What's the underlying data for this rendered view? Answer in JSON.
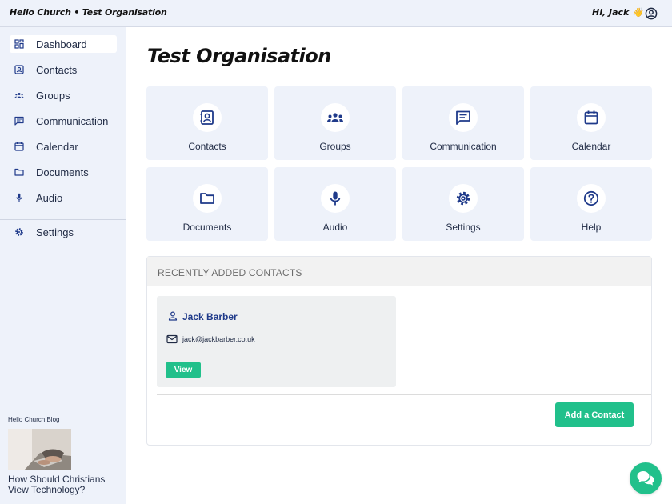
{
  "header": {
    "brand": "Hello Church • Test Organisation",
    "greeting": "Hi, Jack 👋"
  },
  "sidebar": {
    "items": [
      {
        "label": "Dashboard",
        "icon": "grid-icon",
        "active": true
      },
      {
        "label": "Contacts",
        "icon": "contact-card-icon"
      },
      {
        "label": "Groups",
        "icon": "users-icon"
      },
      {
        "label": "Communication",
        "icon": "message-icon"
      },
      {
        "label": "Calendar",
        "icon": "calendar-icon"
      },
      {
        "label": "Documents",
        "icon": "folder-icon"
      },
      {
        "label": "Audio",
        "icon": "microphone-icon"
      },
      {
        "label": "Settings",
        "icon": "gear-icon"
      }
    ],
    "blog": {
      "heading": "Hello Church Blog",
      "title": "How Should Christians View Technology?"
    }
  },
  "main": {
    "title": "Test Organisation",
    "tiles": [
      {
        "label": "Contacts",
        "icon": "contact-card-icon"
      },
      {
        "label": "Groups",
        "icon": "users-icon"
      },
      {
        "label": "Communication",
        "icon": "message-icon"
      },
      {
        "label": "Calendar",
        "icon": "calendar-icon"
      },
      {
        "label": "Documents",
        "icon": "folder-icon"
      },
      {
        "label": "Audio",
        "icon": "microphone-icon"
      },
      {
        "label": "Settings",
        "icon": "gear-icon"
      },
      {
        "label": "Help",
        "icon": "help-icon"
      }
    ],
    "recent": {
      "title": "RECENTLY ADDED CONTACTS",
      "contacts": [
        {
          "name": "Jack Barber",
          "email": "jack@jackbarber.co.uk",
          "view_label": "View"
        }
      ],
      "add_label": "Add a Contact"
    }
  },
  "colors": {
    "accent": "#21c08b",
    "sidebar_bg": "#eef2fa",
    "link": "#1f3a8a"
  }
}
